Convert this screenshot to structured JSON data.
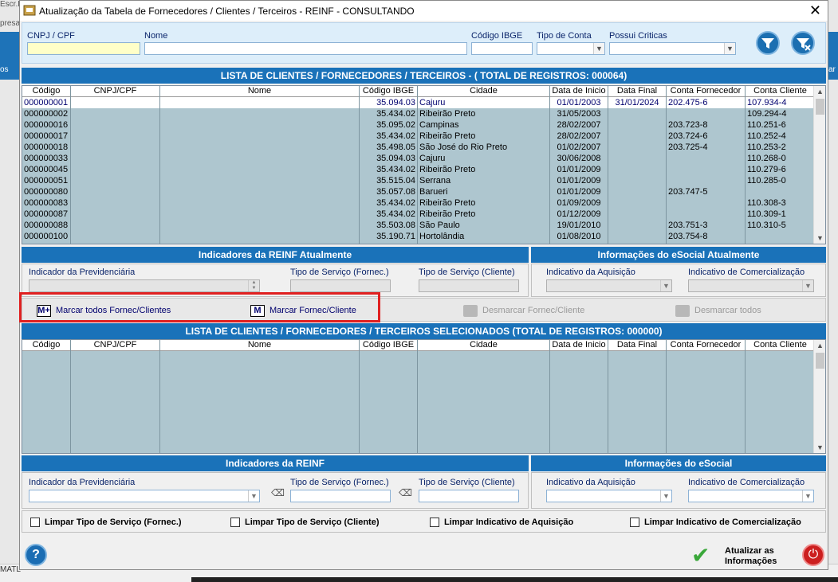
{
  "background": {
    "left_text_1": "Escr.F",
    "left_text_2": "presa",
    "left_strip_text": "os",
    "right_strip_text": "ar",
    "bottom_left_text": "MATL"
  },
  "window": {
    "title": "Atualização da Tabela de Fornecedores / Clientes / Terceiros - REINF   -   CONSULTANDO",
    "close_glyph": "✕"
  },
  "filters": {
    "cnpj_label": "CNPJ / CPF",
    "cnpj_value": "",
    "nome_label": "Nome",
    "nome_value": "",
    "ibge_label": "Código IBGE",
    "ibge_value": "",
    "tipo_conta_label": "Tipo de Conta",
    "tipo_conta_value": "",
    "criticas_label": "Possui Criticas",
    "criticas_value": ""
  },
  "list1": {
    "header": "LISTA DE CLIENTES / FORNECEDORES / TERCEIROS  -  ( TOTAL DE REGISTROS: 000064)",
    "columns": [
      "Código",
      "CNPJ/CPF",
      "Nome",
      "Código IBGE",
      "Cidade",
      "Data de Inicio",
      "Data Final",
      "Conta Fornecedor",
      "Conta Cliente"
    ],
    "rows": [
      [
        "000000001",
        "",
        "",
        "35.094.03",
        "Cajuru",
        "01/01/2003",
        "31/01/2024",
        "202.475-6",
        "107.934-4"
      ],
      [
        "000000002",
        "",
        "",
        "35.434.02",
        "Ribeirão Preto",
        "31/05/2003",
        "",
        "",
        "109.294-4"
      ],
      [
        "000000016",
        "",
        "",
        "35.095.02",
        "Campinas",
        "28/02/2007",
        "",
        "203.723-8",
        "110.251-6"
      ],
      [
        "000000017",
        "",
        "",
        "35.434.02",
        "Ribeirão Preto",
        "28/02/2007",
        "",
        "203.724-6",
        "110.252-4"
      ],
      [
        "000000018",
        "",
        "",
        "35.498.05",
        "São José do Rio Preto",
        "01/02/2007",
        "",
        "203.725-4",
        "110.253-2"
      ],
      [
        "000000033",
        "",
        "",
        "35.094.03",
        "Cajuru",
        "30/06/2008",
        "",
        "",
        "110.268-0"
      ],
      [
        "000000045",
        "",
        "",
        "35.434.02",
        "Ribeirão Preto",
        "01/01/2009",
        "",
        "",
        "110.279-6"
      ],
      [
        "000000051",
        "",
        "",
        "35.515.04",
        "Serrana",
        "01/01/2009",
        "",
        "",
        "110.285-0"
      ],
      [
        "000000080",
        "",
        "",
        "35.057.08",
        "Barueri",
        "01/01/2009",
        "",
        "203.747-5",
        ""
      ],
      [
        "000000083",
        "",
        "",
        "35.434.02",
        "Ribeirão Preto",
        "01/09/2009",
        "",
        "",
        "110.308-3"
      ],
      [
        "000000087",
        "",
        "",
        "35.434.02",
        "Ribeirão Preto",
        "01/12/2009",
        "",
        "",
        "110.309-1"
      ],
      [
        "000000088",
        "",
        "",
        "35.503.08",
        "São Paulo",
        "19/01/2010",
        "",
        "203.751-3",
        "110.310-5"
      ],
      [
        "000000100",
        "",
        "",
        "35.190.71",
        "Hortolândia",
        "01/08/2010",
        "",
        "203.754-8",
        ""
      ]
    ]
  },
  "reinf_current": {
    "header": "Indicadores da REINF Atualmente",
    "prev_label": "Indicador da Previdenciária",
    "serv_forn_label": "Tipo de Serviço (Fornec.)",
    "serv_cli_label": "Tipo de Serviço (Cliente)"
  },
  "esocial_current": {
    "header": "Informações do eSocial Atualmente",
    "aquis_label": "Indicativo da Aquisição",
    "comerc_label": "Indicativo de Comercialização"
  },
  "actions": {
    "mark_all": "Marcar todos Fornec/Clientes",
    "mark_all_icon": "M+",
    "mark_one": "Marcar Fornec/Cliente",
    "mark_one_icon": "M",
    "unmark_one": "Desmarcar Fornec/Cliente",
    "unmark_all": "Desmarcar todos"
  },
  "list2": {
    "header": "LISTA DE CLIENTES / FORNECEDORES / TERCEIROS SELECIONADOS (TOTAL DE REGISTROS: 000000)",
    "columns": [
      "Código",
      "CNPJ/CPF",
      "Nome",
      "Código IBGE",
      "Cidade",
      "Data de Inicio",
      "Data Final",
      "Conta Fornecedor",
      "Conta Cliente"
    ]
  },
  "reinf_new": {
    "header": "Indicadores da REINF",
    "prev_label": "Indicador da Previdenciária",
    "serv_forn_label": "Tipo de Serviço (Fornec.)",
    "serv_cli_label": "Tipo de Serviço (Cliente)"
  },
  "esocial_new": {
    "header": "Informações do eSocial",
    "aquis_label": "Indicativo da Aquisição",
    "comerc_label": "Indicativo de Comercialização"
  },
  "checks": {
    "limpar_forn": "Limpar Tipo de Serviço (Fornec.)",
    "limpar_cli": "Limpar Tipo de Serviço (Cliente)",
    "limpar_aquis": "Limpar Indicativo de Aquisição",
    "limpar_comerc": "Limpar Indicativo de Comercialização"
  },
  "footer": {
    "help_glyph": "?",
    "update_label": "Atualizar as\nInformações",
    "update_glyph": "✔",
    "power_glyph": "⏻"
  },
  "colors": {
    "header_blue": "#1a72b9",
    "grid_row_bg": "#aec6cf",
    "highlight_red": "#e02020"
  }
}
